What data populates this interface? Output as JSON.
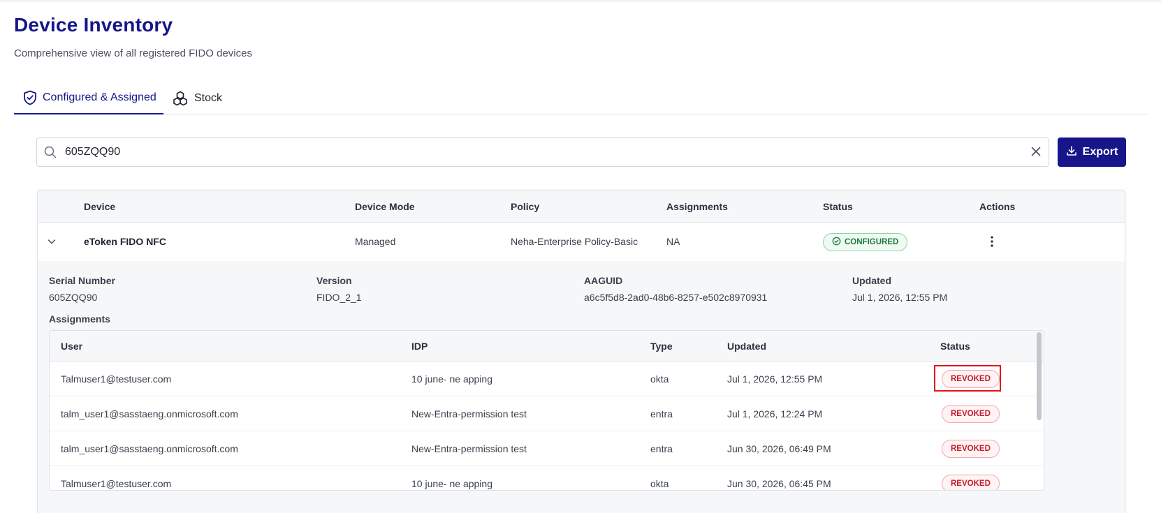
{
  "page": {
    "title": "Device Inventory",
    "subtitle": "Comprehensive view of all registered FIDO devices"
  },
  "tabs": [
    {
      "label": "Configured & Assigned",
      "icon": "shield-check-icon",
      "active": true
    },
    {
      "label": "Stock",
      "icon": "cubes-icon",
      "active": false
    }
  ],
  "search": {
    "value": "605ZQQ90",
    "placeholder": ""
  },
  "toolbar": {
    "export_label": "Export"
  },
  "colors": {
    "primary": "#16168a",
    "configured": "#1f7a3b",
    "revoked": "#c21c2b",
    "highlight": "#e0161f"
  },
  "devices_table": {
    "columns": [
      "Device",
      "Device Mode",
      "Policy",
      "Assignments",
      "Status",
      "Actions"
    ],
    "rows": [
      {
        "device": "eToken FIDO NFC",
        "mode": "Managed",
        "policy": "Neha-Enterprise Policy-Basic",
        "assignments": "NA",
        "status": "CONFIGURED",
        "expanded": true
      }
    ]
  },
  "details": {
    "serial_label": "Serial Number",
    "serial_value": "605ZQQ90",
    "version_label": "Version",
    "version_value": "FIDO_2_1",
    "aaguid_label": "AAGUID",
    "aaguid_value": "a6c5f5d8-2ad0-48b6-8257-e502c8970931",
    "updated_label": "Updated",
    "updated_value": "Jul 1, 2026, 12:55 PM",
    "assignments_label": "Assignments"
  },
  "assignments_table": {
    "columns": [
      "User",
      "IDP",
      "Type",
      "Updated",
      "Status"
    ],
    "rows": [
      {
        "user": "Talmuser1@testuser.com",
        "idp": "10 june- ne apping",
        "type": "okta",
        "updated": "Jul 1, 2026, 12:55 PM",
        "status": "REVOKED"
      },
      {
        "user": "talm_user1@sasstaeng.onmicrosoft.com",
        "idp": "New-Entra-permission test",
        "type": "entra",
        "updated": "Jul 1, 2026, 12:24 PM",
        "status": "REVOKED"
      },
      {
        "user": "talm_user1@sasstaeng.onmicrosoft.com",
        "idp": "New-Entra-permission test",
        "type": "entra",
        "updated": "Jun 30, 2026, 06:49 PM",
        "status": "REVOKED"
      },
      {
        "user": "Talmuser1@testuser.com",
        "idp": "10 june- ne apping",
        "type": "okta",
        "updated": "Jun 30, 2026, 06:45 PM",
        "status": "REVOKED"
      }
    ]
  }
}
